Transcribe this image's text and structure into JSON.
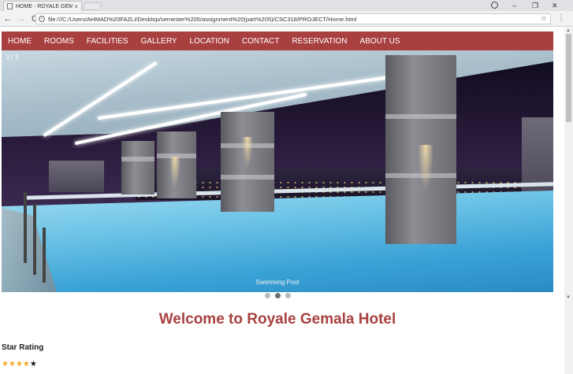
{
  "browser": {
    "tab_title": "HOME - ROYALE GEMALA",
    "tab_close": "×",
    "url": "file:///C:/Users/AHMAD%20FAZLI/Desktop/semester%205/assignment%20(part%205)/CSC318/PROJECT/Home.html",
    "back": "←",
    "forward": "→",
    "reload": "C",
    "bookmark_star": "☆",
    "menu": "⋮",
    "minimize": "–",
    "restore": "❐",
    "close": "✕"
  },
  "nav": {
    "items": [
      "HOME",
      "ROOMS",
      "FACILITIES",
      "GALLERY",
      "LOCATION",
      "CONTACT",
      "RESERVATION",
      "ABOUT US"
    ],
    "color": "#a84040"
  },
  "slideshow": {
    "counter": "2 / 3",
    "caption": "Swimming Pool",
    "active_dot": 2,
    "dot_count": 3
  },
  "main": {
    "welcome": "Welcome to Royale Gemala Hotel",
    "rating_title": "Star Rating",
    "rating_filled": 4,
    "rating_total": 5,
    "star_color": "#f5a623"
  }
}
